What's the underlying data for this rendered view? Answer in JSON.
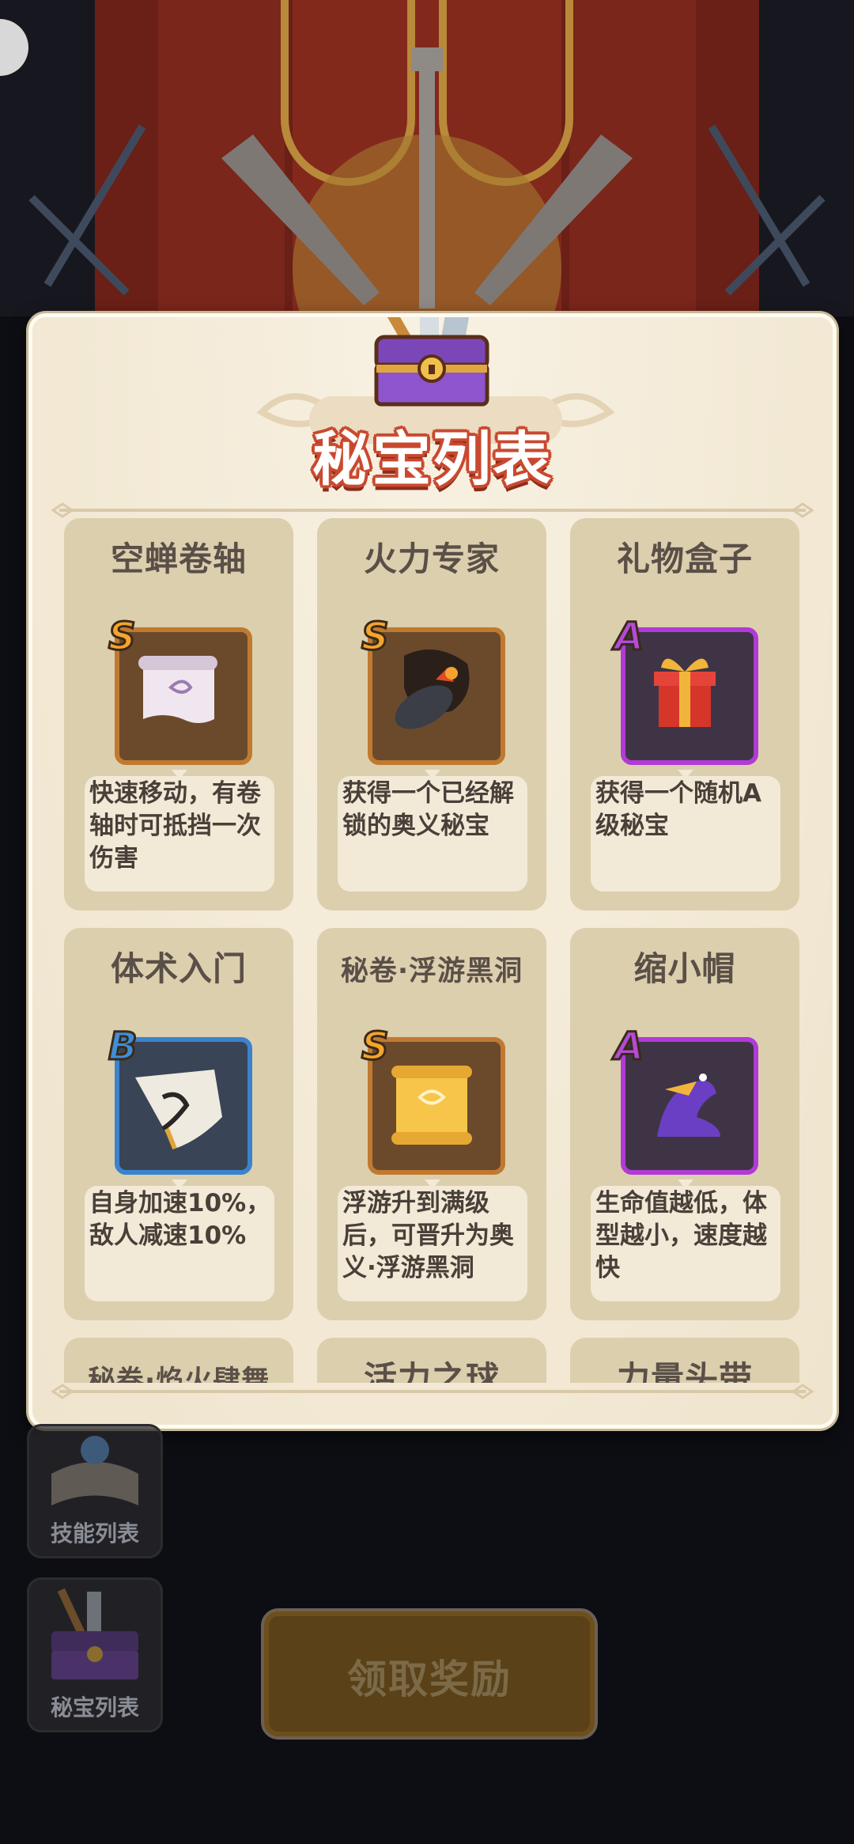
{
  "panel": {
    "title": "秘宝列表",
    "items": [
      {
        "name": "空蝉卷轴",
        "rank": "S",
        "rank_color": "#f6a52b",
        "frame_color": "#c07a30",
        "desc": "快速移动，有卷轴时可抵挡一次伤害",
        "icon": "scroll-icon"
      },
      {
        "name": "火力专家",
        "rank": "S",
        "rank_color": "#f6a52b",
        "frame_color": "#c07a30",
        "desc": "获得一个已经解锁的奥义秘宝",
        "icon": "bomb-icon"
      },
      {
        "name": "礼物盒子",
        "rank": "A",
        "rank_color": "#b44ad8",
        "frame_color": "#b13bd6",
        "desc": "获得一个随机A级秘宝",
        "icon": "gift-box-icon"
      },
      {
        "name": "体术入门",
        "rank": "B",
        "rank_color": "#3e8fd9",
        "frame_color": "#3b83cc",
        "desc": "自身加速10%，敌人减速10%",
        "icon": "martial-scroll-icon"
      },
      {
        "name": "秘卷·浮游黑洞",
        "rank": "S",
        "rank_color": "#f6a52b",
        "frame_color": "#c07a30",
        "desc": "浮游升到满级后，可晋升为奥义·浮游黑洞",
        "icon": "golden-scroll-icon"
      },
      {
        "name": "缩小帽",
        "rank": "A",
        "rank_color": "#b44ad8",
        "frame_color": "#b13bd6",
        "desc": "生命值越低，体型越小，速度越快",
        "icon": "bird-hat-icon"
      },
      {
        "name": "秘卷·焰火肆舞",
        "rank": "",
        "desc": ""
      },
      {
        "name": "活力之球",
        "rank": "",
        "desc": ""
      },
      {
        "name": "力量头带",
        "rank": "",
        "desc": ""
      }
    ]
  },
  "sidebar": {
    "skill_list_label": "技能列表",
    "treasure_list_label": "秘宝列表"
  },
  "claim_button": {
    "label": "领取奖励"
  },
  "colors": {
    "panel_bg": "#f4ecdb",
    "card_bg": "#dccfae",
    "title_red": "#c9492f"
  }
}
